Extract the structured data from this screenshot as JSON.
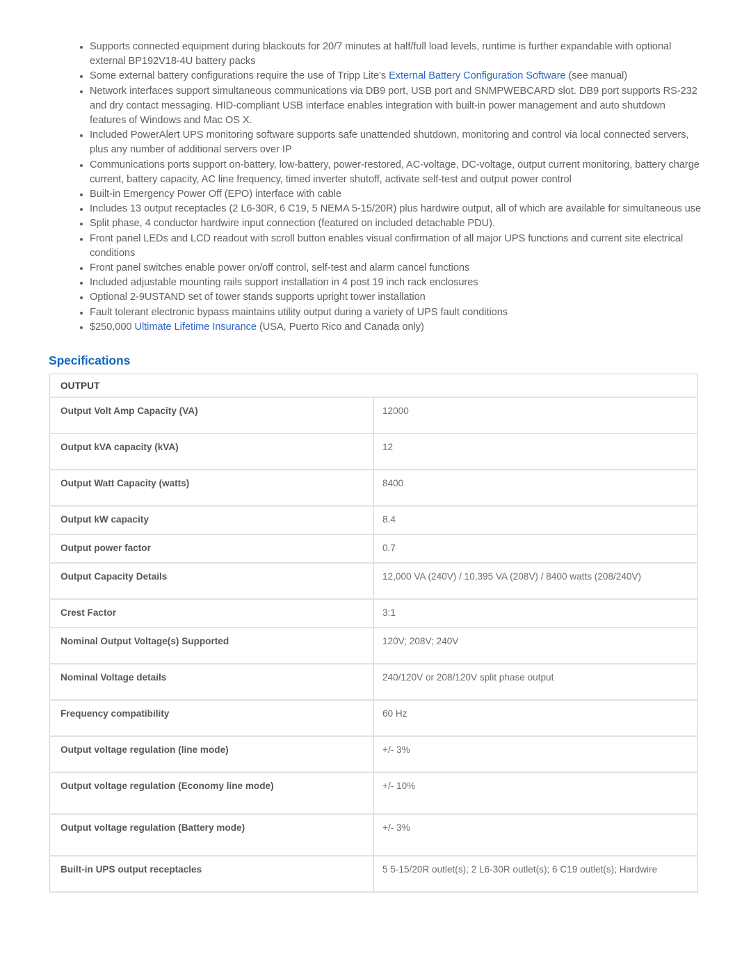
{
  "features": {
    "items": [
      {
        "segments": [
          {
            "text": "Supports connected equipment during blackouts for 20/7 minutes at half/full load levels, runtime is further expandable with optional external BP192V18-4U battery packs",
            "link": false
          }
        ]
      },
      {
        "segments": [
          {
            "text": "Some external battery configurations require the use of Tripp Lite's ",
            "link": false
          },
          {
            "text": "External Battery Configuration Software",
            "link": true
          },
          {
            "text": " (see manual)",
            "link": false
          }
        ]
      },
      {
        "segments": [
          {
            "text": "Network interfaces support simultaneous communications via DB9 port, USB port and SNMPWEBCARD slot. DB9 port supports RS-232 and dry contact messaging. HID-compliant USB interface enables integration with built-in power management and auto shutdown features of Windows and Mac OS X.",
            "link": false
          }
        ]
      },
      {
        "segments": [
          {
            "text": "Included PowerAlert UPS monitoring software supports safe unattended shutdown, monitoring and control via local connected servers, plus any number of additional servers over IP",
            "link": false
          }
        ]
      },
      {
        "segments": [
          {
            "text": "Communications ports support on-battery, low-battery, power-restored, AC-voltage, DC-voltage, output current monitoring, battery charge current, battery capacity, AC line frequency, timed inverter shutoff, activate self-test and output power control",
            "link": false
          }
        ]
      },
      {
        "segments": [
          {
            "text": "Built-in Emergency Power Off (EPO) interface with cable",
            "link": false
          }
        ]
      },
      {
        "segments": [
          {
            "text": "Includes 13 output receptacles (2 L6-30R, 6 C19, 5 NEMA 5-15/20R) plus hardwire output, all of which are available for simultaneous use",
            "link": false
          }
        ]
      },
      {
        "segments": [
          {
            "text": "Split phase, 4 conductor hardwire input connection (featured on included detachable PDU).",
            "link": false
          }
        ]
      },
      {
        "segments": [
          {
            "text": "Front panel LEDs and LCD readout with scroll button enables visual confirmation of all major UPS functions and current site electrical conditions",
            "link": false
          }
        ]
      },
      {
        "segments": [
          {
            "text": "Front panel switches enable power on/off control, self-test and alarm cancel functions",
            "link": false
          }
        ]
      },
      {
        "segments": [
          {
            "text": "Included adjustable mounting rails support installation in 4 post 19 inch rack enclosures",
            "link": false
          }
        ]
      },
      {
        "segments": [
          {
            "text": "Optional 2-9USTAND set of tower stands supports upright tower installation",
            "link": false
          }
        ]
      },
      {
        "segments": [
          {
            "text": "Fault tolerant electronic bypass maintains utility output during a variety of UPS fault conditions",
            "link": false
          }
        ]
      },
      {
        "segments": [
          {
            "text": "$250,000 ",
            "link": false
          },
          {
            "text": "Ultimate Lifetime Insurance",
            "link": true
          },
          {
            "text": " (USA, Puerto Rico and Canada only)",
            "link": false
          }
        ]
      }
    ]
  },
  "specifications": {
    "heading": "Specifications",
    "section_title": "OUTPUT",
    "rows": [
      {
        "label": "Output Volt Amp Capacity (VA)",
        "value": "12000",
        "size": "tall-1"
      },
      {
        "label": "Output kVA capacity (kVA)",
        "value": "12",
        "size": "tall-1"
      },
      {
        "label": "Output Watt Capacity (watts)",
        "value": "8400",
        "size": "tall-1"
      },
      {
        "label": "Output kW capacity",
        "value": "8.4",
        "size": ""
      },
      {
        "label": "Output power factor",
        "value": "0.7",
        "size": ""
      },
      {
        "label": "Output Capacity Details",
        "value": "12,000 VA (240V) / 10,395 VA (208V) / 8400 watts (208/240V)",
        "size": "tall-1"
      },
      {
        "label": "Crest Factor",
        "value": "3:1",
        "size": ""
      },
      {
        "label": "Nominal Output Voltage(s) Supported",
        "value": "120V; 208V; 240V",
        "size": "tall-1"
      },
      {
        "label": "Nominal Voltage details",
        "value": "240/120V or 208/120V split phase output",
        "size": "tall-1"
      },
      {
        "label": "Frequency compatibility",
        "value": "60 Hz",
        "size": "tall-1"
      },
      {
        "label": "Output voltage regulation (line mode)",
        "value": "+/- 3%",
        "size": "tall-1"
      },
      {
        "label": "Output voltage regulation (Economy line mode)",
        "value": "+/- 10%",
        "size": "tall-2"
      },
      {
        "label": "Output voltage regulation (Battery mode)",
        "value": "+/- 3%",
        "size": "tall-2"
      },
      {
        "label": "Built-in UPS output receptacles",
        "value": "5 5-15/20R outlet(s); 2 L6-30R outlet(s); 6 C19 outlet(s); Hardwire",
        "size": "tall-1"
      }
    ]
  },
  "colors": {
    "link": "#2f66c4",
    "heading": "#1566c0",
    "body_text": "#5f5f5f",
    "label_text": "#585858",
    "value_text": "#6c6c6c",
    "border": "#e2e2e2"
  }
}
